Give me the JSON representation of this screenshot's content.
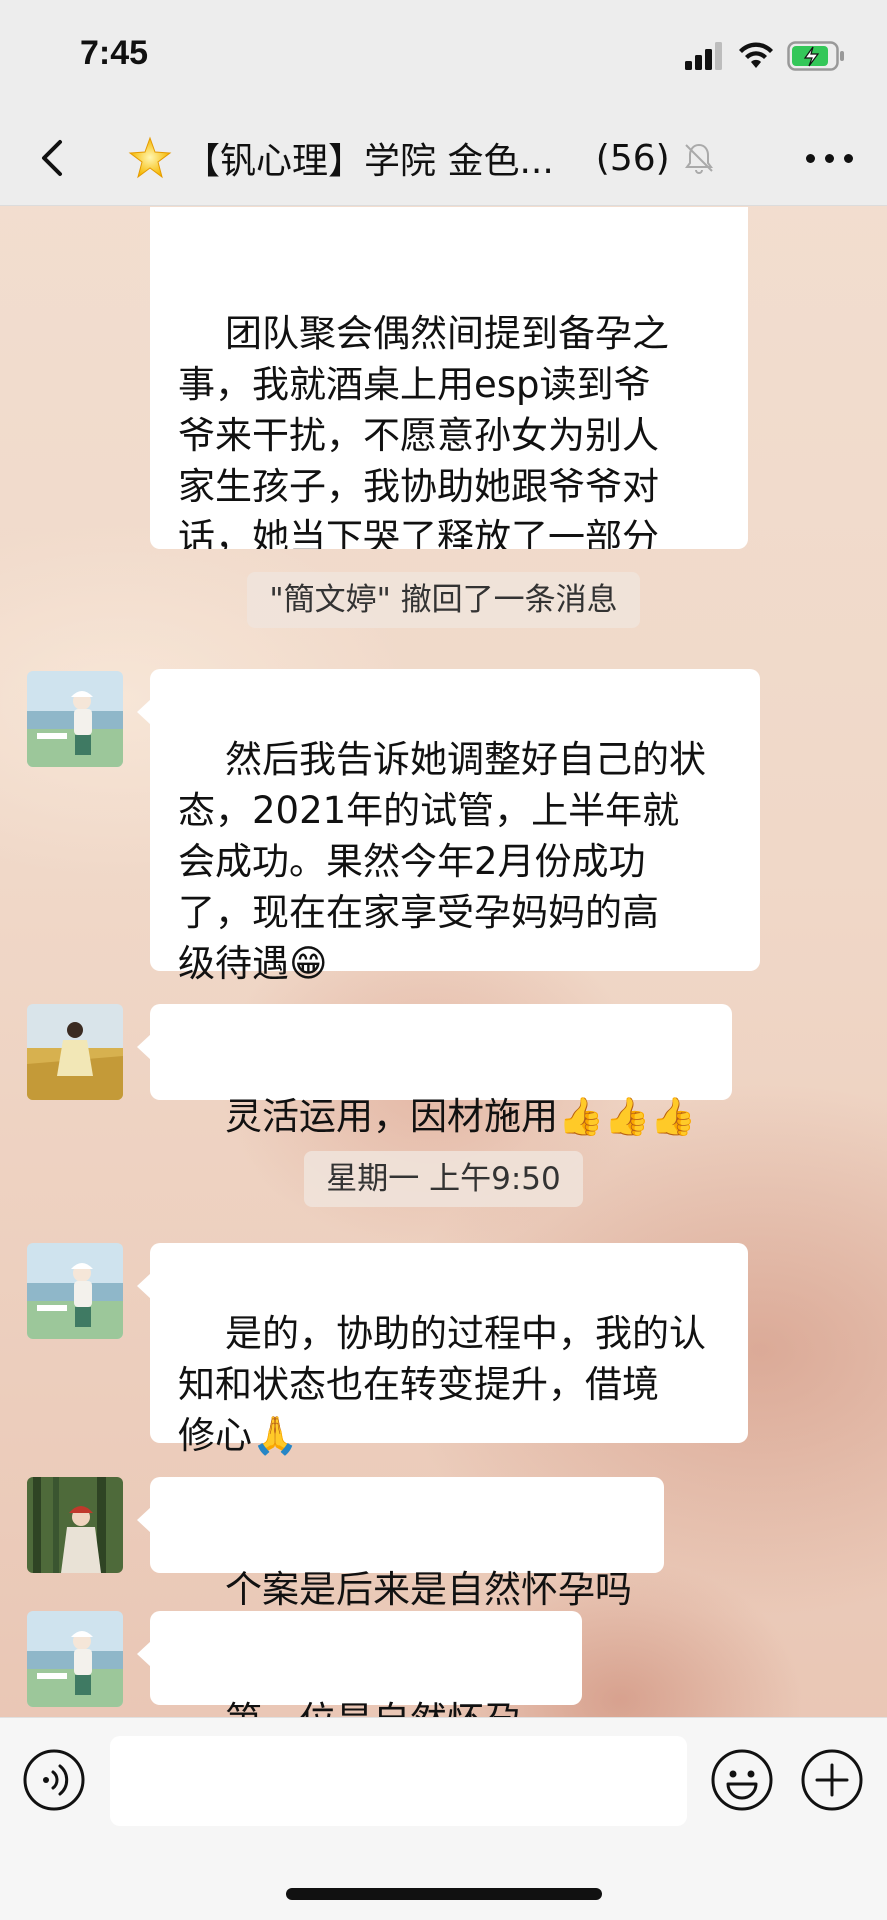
{
  "status_bar": {
    "time": "7:45"
  },
  "header": {
    "title": "【钒心理】学院 金色...",
    "member_count": "(56)"
  },
  "messages": {
    "m1": "团队聚会偶然间提到备孕之\n事，我就酒桌上用esp读到爷\n爷来干扰，不愿意孙女为别人\n家生孩子，我协助她跟爷爷对\n话，她当下哭了释放了一部分\n家族的纠缠。",
    "recall": "\"簡文婷\" 撤回了一条消息",
    "m2": "然后我告诉她调整好自己的状\n态，2021年的试管，上半年就\n会成功。果然今年2月份成功\n了，现在在家享受孕妈妈的高\n级待遇😁",
    "m3": "灵活运用，因材施用👍👍👍",
    "timestamp": "星期一 上午9:50",
    "m4": "是的，协助的过程中，我的认\n知和状态也在转变提升，借境\n修心🙏",
    "m5": "个案是后来是自然怀孕吗",
    "m6": "第一位是自然怀孕的"
  },
  "input": {
    "placeholder": ""
  },
  "colors": {
    "bubble": "#ffffff",
    "nav_bg": "#ededed",
    "battery_green": "#34c759"
  },
  "icons": [
    "back-icon",
    "star-icon",
    "mute-icon",
    "more-icon",
    "voice-icon",
    "emoji-icon",
    "plus-icon"
  ]
}
